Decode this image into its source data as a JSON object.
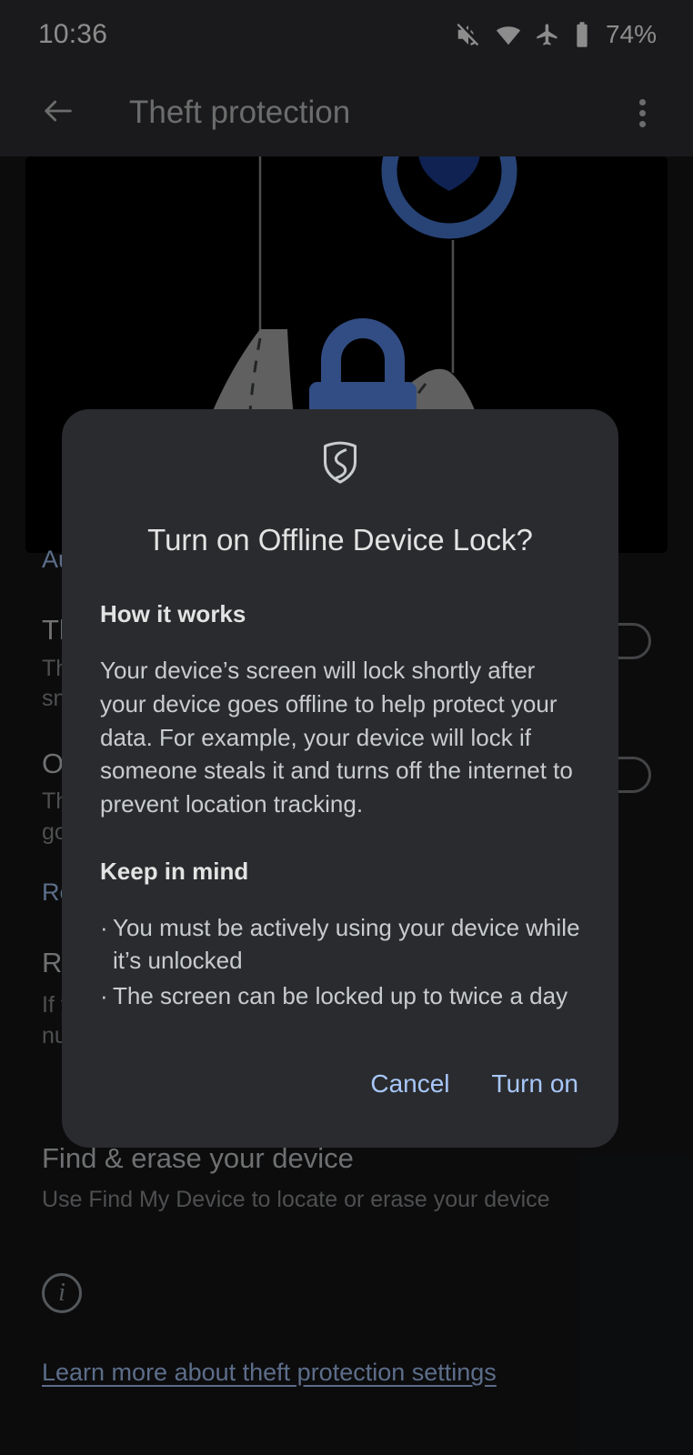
{
  "status_bar": {
    "time": "10:36",
    "battery_percent": "74%",
    "icons": [
      "mute-icon",
      "wifi-icon",
      "airplane-mode-icon",
      "battery-icon"
    ]
  },
  "app_bar": {
    "back_icon": "back-arrow-icon",
    "title": "Theft protection",
    "overflow_icon": "more-options-icon"
  },
  "hero": {
    "alt": "illustration of hands holding a phone with a lock and shield",
    "lock_color": "#5b8def",
    "shield_color": "#1c3f94",
    "hand_color": "#b0b0b0"
  },
  "page": {
    "auto_link": "Automatically lock your device",
    "settings": [
      {
        "title": "Theft Detection Lock",
        "desc": "The screen locks automatically if someone snatches the device from you",
        "toggle": "off"
      },
      {
        "title": "Offline Device Lock",
        "desc": "The screen locks automatically when the device goes offline",
        "toggle": "off"
      }
    ],
    "remote_link": "Remotely lock your device",
    "remote_section": {
      "title": "Remote Lock",
      "desc": "If you lose your device, lock the screen with just a phone number"
    },
    "find_section": {
      "title": "Find & erase your device",
      "desc": "Use Find My Device to locate or erase your device"
    },
    "info_icon": "info-icon",
    "learn_more": "Learn more about theft protection settings"
  },
  "dialog": {
    "icon": "shield-icon",
    "title": "Turn on Offline Device Lock?",
    "how_it_works_heading": "How it works",
    "how_it_works_body": "Your device’s screen will lock shortly after your device goes offline to help protect your data. For example, your device will lock if someone steals it and turns off the internet to prevent location tracking.",
    "keep_in_mind_heading": "Keep in mind",
    "bullets": [
      "You must be actively using your device while it’s unlocked",
      "The screen can be locked up to twice a day"
    ],
    "bullet_marker": "·",
    "cancel_label": "Cancel",
    "confirm_label": "Turn on",
    "accent_color": "#a8c7fa",
    "background_color": "#2a2b2e"
  }
}
